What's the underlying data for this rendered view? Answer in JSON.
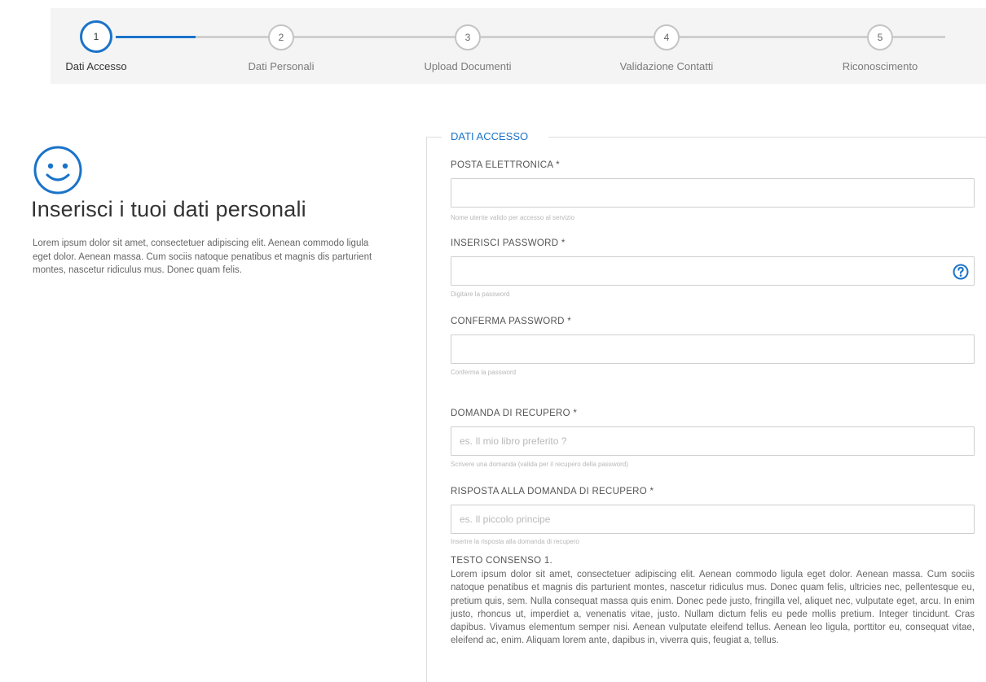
{
  "stepper": {
    "steps": [
      {
        "number": "1",
        "label": "Dati Accesso"
      },
      {
        "number": "2",
        "label": "Dati Personali"
      },
      {
        "number": "3",
        "label": "Upload Documenti"
      },
      {
        "number": "4",
        "label": "Validazione Contatti"
      },
      {
        "number": "5",
        "label": "Riconoscimento"
      }
    ],
    "active_step": 1,
    "accent_color": "#1a73c9"
  },
  "left": {
    "icon": "smiley-face-icon",
    "title": "Inserisci i tuoi dati personali",
    "description": "Lorem ipsum dolor sit amet, consectetuer adipiscing elit. Aenean commodo ligula eget dolor. Aenean massa. Cum sociis natoque penatibus et magnis dis parturient montes, nascetur ridiculus mus. Donec quam felis."
  },
  "form": {
    "legend": "DATI ACCESSO",
    "email": {
      "label": "POSTA ELETTRONICA *",
      "value": "",
      "placeholder": "",
      "hint": "Nome utente valido per accesso al servizio"
    },
    "password": {
      "label": "INSERISCI PASSWORD *",
      "value": "",
      "placeholder": "",
      "hint": "Digitare la password",
      "help_icon": "question-circle-icon"
    },
    "confirm_password": {
      "label": "CONFERMA PASSWORD *",
      "value": "",
      "placeholder": "",
      "hint": "Conferma la password"
    },
    "recovery_question": {
      "label": "DOMANDA DI RECUPERO *",
      "value": "",
      "placeholder": "es. Il mio libro preferito ?",
      "hint": "Scrivere una domanda (valida per il recupero della password)"
    },
    "recovery_answer": {
      "label": "RISPOSTA ALLA DOMANDA DI RECUPERO *",
      "value": "",
      "placeholder": "es. Il piccolo principe",
      "hint": "Inserire la risposta alla domanda di recupero"
    },
    "consent": {
      "title": "TESTO CONSENSO 1.",
      "text": "Lorem ipsum dolor sit amet, consectetuer adipiscing elit. Aenean commodo ligula eget dolor. Aenean massa. Cum sociis natoque penatibus et magnis dis parturient montes, nascetur ridiculus mus. Donec quam felis, ultricies nec, pellentesque eu, pretium quis, sem. Nulla consequat massa quis enim. Donec pede justo, fringilla vel, aliquet nec, vulputate eget, arcu. In enim justo, rhoncus ut, imperdiet a, venenatis vitae, justo. Nullam dictum felis eu pede mollis pretium. Integer tincidunt. Cras dapibus. Vivamus elementum semper nisi. Aenean vulputate eleifend tellus. Aenean leo ligula, porttitor eu, consequat vitae, eleifend ac, enim. Aliquam lorem ante, dapibus in, viverra quis, feugiat a, tellus."
    }
  }
}
